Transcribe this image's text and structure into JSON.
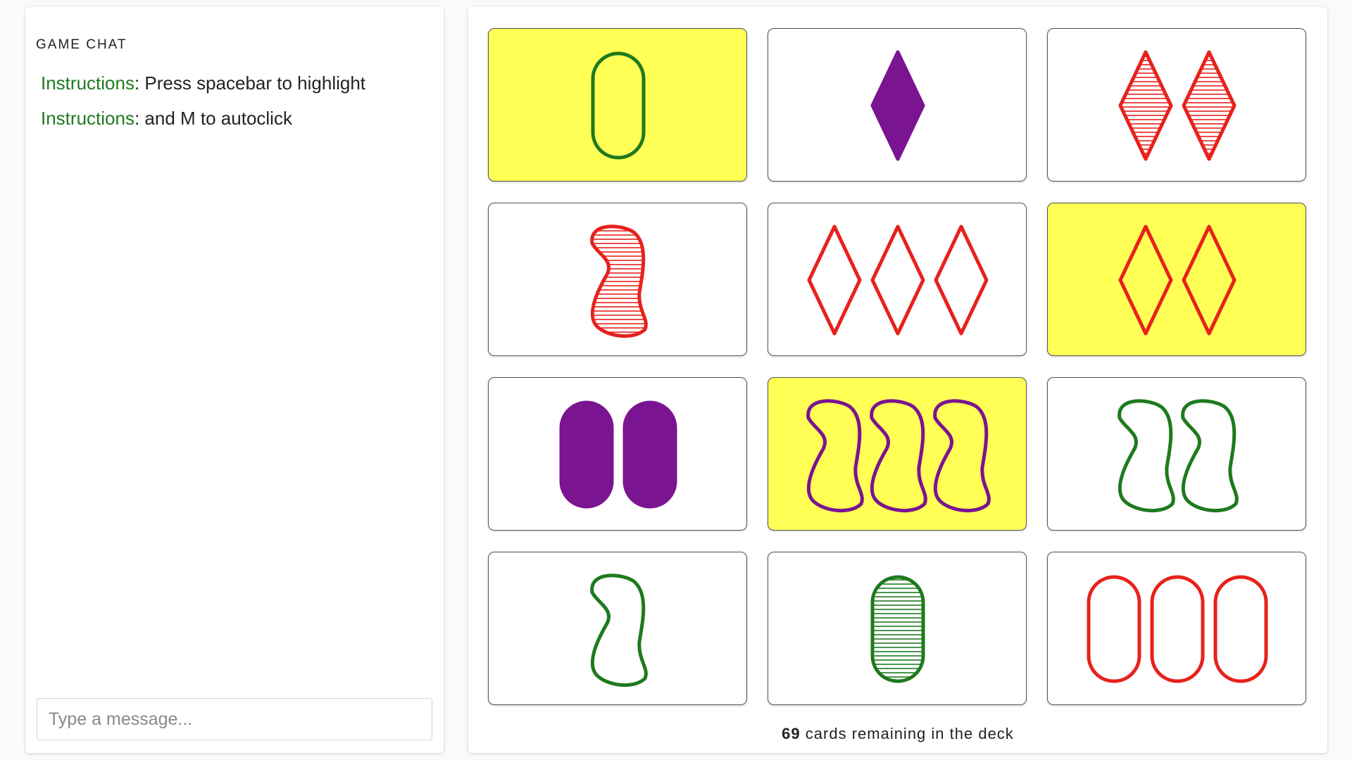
{
  "chat": {
    "title": "GAME CHAT",
    "messages": [
      {
        "sender": "Instructions",
        "text": "Press spacebar to highlight"
      },
      {
        "sender": "Instructions",
        "text": "and M to autoclick"
      }
    ],
    "input_placeholder": "Type a message..."
  },
  "board": {
    "cards": [
      {
        "count": 1,
        "shape": "oval",
        "color": "#1e7a1e",
        "shading": "empty",
        "selected": true
      },
      {
        "count": 1,
        "shape": "diamond",
        "color": "#7a1490",
        "shading": "solid",
        "selected": false
      },
      {
        "count": 2,
        "shape": "diamond",
        "color": "#e8211b",
        "shading": "striped",
        "selected": false
      },
      {
        "count": 1,
        "shape": "squiggle",
        "color": "#e8211b",
        "shading": "striped",
        "selected": false
      },
      {
        "count": 3,
        "shape": "diamond",
        "color": "#e8211b",
        "shading": "empty",
        "selected": false
      },
      {
        "count": 2,
        "shape": "diamond",
        "color": "#e8211b",
        "shading": "empty",
        "selected": true
      },
      {
        "count": 2,
        "shape": "oval",
        "color": "#7a1490",
        "shading": "solid",
        "selected": false
      },
      {
        "count": 3,
        "shape": "squiggle",
        "color": "#7a1490",
        "shading": "empty",
        "selected": true
      },
      {
        "count": 2,
        "shape": "squiggle",
        "color": "#1e7a1e",
        "shading": "empty",
        "selected": false
      },
      {
        "count": 1,
        "shape": "squiggle",
        "color": "#1e7a1e",
        "shading": "empty",
        "selected": false
      },
      {
        "count": 1,
        "shape": "oval",
        "color": "#1e7a1e",
        "shading": "striped",
        "selected": false
      },
      {
        "count": 3,
        "shape": "oval",
        "color": "#e8211b",
        "shading": "empty",
        "selected": false
      }
    ],
    "deck_count": "69",
    "deck_text": "cards remaining in the deck"
  }
}
